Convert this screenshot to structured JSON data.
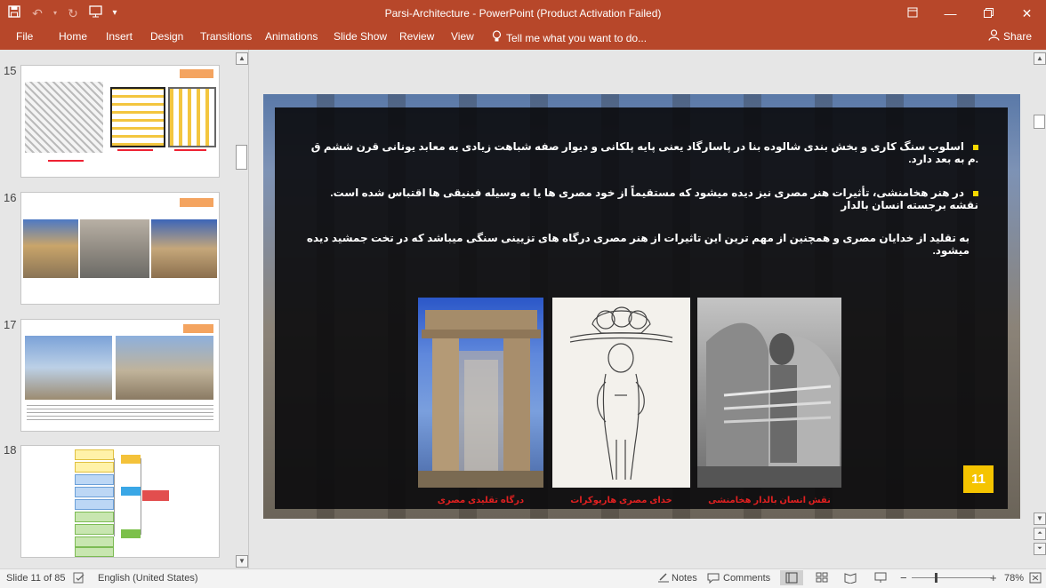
{
  "window": {
    "title": "Parsi-Architecture - PowerPoint (Product Activation Failed)",
    "qat_icons": [
      "save-icon",
      "undo-icon",
      "redo-icon",
      "start-slideshow-icon",
      "customize-qat-icon"
    ],
    "controls": [
      "ribbon-display-icon",
      "minimize-icon",
      "maximize-icon",
      "close-icon"
    ]
  },
  "ribbon": {
    "tabs": [
      "File",
      "Home",
      "Insert",
      "Design",
      "Transitions",
      "Animations",
      "Slide Show",
      "Review",
      "View"
    ],
    "tell_me": "Tell me what you want to do...",
    "share": "Share"
  },
  "thumbnails": [
    {
      "number": "15"
    },
    {
      "number": "16"
    },
    {
      "number": "17"
    },
    {
      "number": "18"
    }
  ],
  "slide": {
    "bullet1": "اسلوب سنگ کاری و بخش بندی شالوده بنا در پاسارگاد یعنی پایه پلکانی و دیوار صفه شباهت زیادی به معابد یونانی قرن ششم ق .م به بعد دارد.",
    "bullet2_line1": "در هنر هخامنشی، تأثیرات هنر مصری نیز دیده میشود که مستقیماً از خود مصری ها یا به وسیله فینیقی ها اقتباس شده است. نقشه برجسته انسان بالدار",
    "bullet2_line2": "به تقلید از خدایان مصری و همچنین از مهم ترین این تاثیرات از هنر مصری درگاه های تزیینی سنگی میباشد که در تخت جمشید دیده میشود.",
    "captions": [
      "درگاه تقلیدی مصری",
      "خدای مصری هارپوکرات",
      "نقش انسان بالدار هخامنشی"
    ],
    "page_number": "11"
  },
  "status": {
    "slide_info": "Slide 11 of 85",
    "language": "English (United States)",
    "notes": "Notes",
    "comments": "Comments",
    "zoom": "78%"
  },
  "colors": {
    "accent": "#b7472a",
    "bullet": "#f5d800",
    "caption": "#e02020",
    "page_number_bg": "#f5c400"
  }
}
